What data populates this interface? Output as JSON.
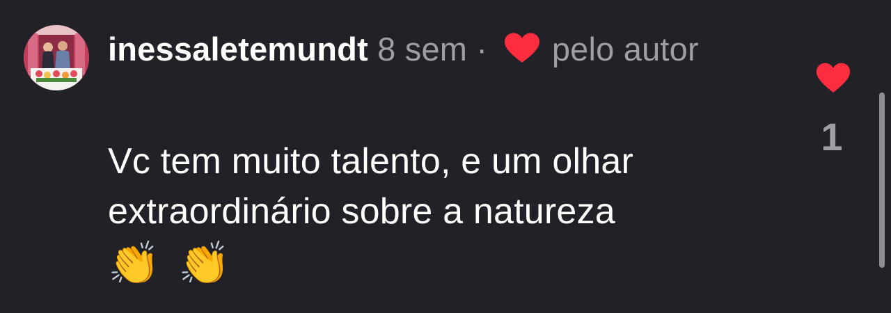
{
  "comment": {
    "username": "inessaletemundt",
    "timestamp": "8 sem",
    "separator": "·",
    "liked_by_author_text": "pelo autor",
    "text": "Vc tem muito talento, e um olhar extraordinário sobre a natureza",
    "emojis": [
      "👏",
      "👏"
    ],
    "like_count": "1",
    "liked": true,
    "colors": {
      "background": "#212127",
      "heart": "#ff2d3f",
      "meta_text": "#9e9fa6",
      "primary_text": "#ffffff"
    },
    "icons": {
      "author_like": "heart-icon",
      "like_button": "heart-filled-icon"
    }
  }
}
